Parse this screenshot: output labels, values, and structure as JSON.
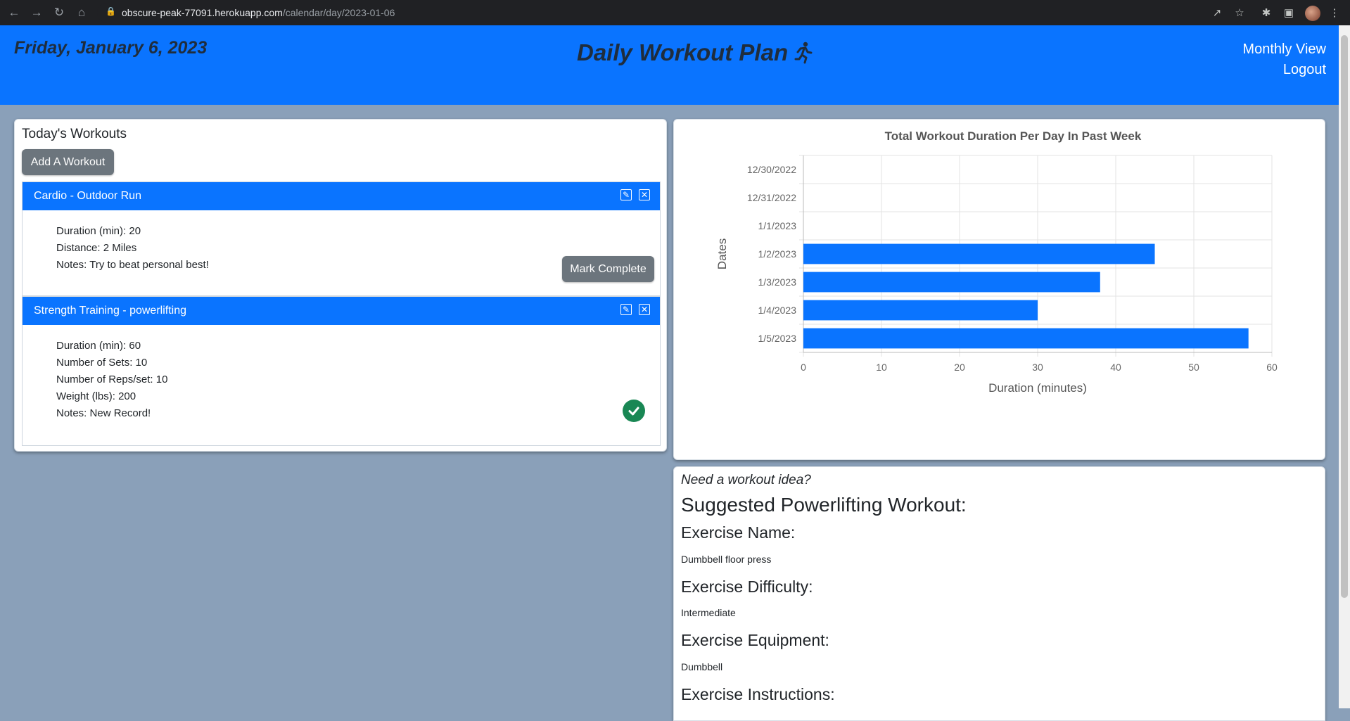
{
  "browser": {
    "url_host": "obscure-peak-77091.herokuapp.com",
    "url_path": "/calendar/day/2023-01-06"
  },
  "header": {
    "date": "Friday, January 6, 2023",
    "title": "Daily Workout Plan",
    "nav": [
      "Monthly View",
      "Logout"
    ]
  },
  "workouts_panel": {
    "heading": "Today's Workouts",
    "add_button": "Add A Workout",
    "items": [
      {
        "title": "Cardio - Outdoor Run",
        "details": [
          "Duration (min): 20",
          "Distance: 2 Miles",
          "Notes: Try to beat personal best!"
        ],
        "action": "Mark Complete",
        "completed": false
      },
      {
        "title": "Strength Training - powerlifting",
        "details": [
          "Duration (min): 60",
          "Number of Sets: 10",
          "Number of Reps/set: 10",
          "Weight (lbs): 200",
          "Notes: New Record!"
        ],
        "completed": true
      }
    ]
  },
  "chart_data": {
    "type": "bar",
    "orientation": "horizontal",
    "title": "Total Workout Duration Per Day In Past Week",
    "xlabel": "Duration (minutes)",
    "ylabel": "Dates",
    "categories": [
      "12/30/2022",
      "12/31/2022",
      "1/1/2023",
      "1/2/2023",
      "1/3/2023",
      "1/4/2023",
      "1/5/2023"
    ],
    "values": [
      0,
      0,
      0,
      45,
      38,
      30,
      57
    ],
    "xlim": [
      0,
      60
    ],
    "xticks": [
      0,
      10,
      20,
      30,
      40,
      50,
      60
    ],
    "grid": true,
    "color": "#0a74ff"
  },
  "suggestion": {
    "prompt": "Need a workout idea?",
    "title": "Suggested Powerlifting Workout:",
    "name_label": "Exercise Name:",
    "name": "Dumbbell floor press",
    "difficulty_label": "Exercise Difficulty:",
    "difficulty": "Intermediate",
    "equipment_label": "Exercise Equipment:",
    "equipment": "Dumbbell",
    "instructions_label": "Exercise Instructions:"
  },
  "colors": {
    "primary": "#0a74ff",
    "background": "#8aa0b9",
    "button_gray": "#6c757d",
    "success": "#198754"
  }
}
